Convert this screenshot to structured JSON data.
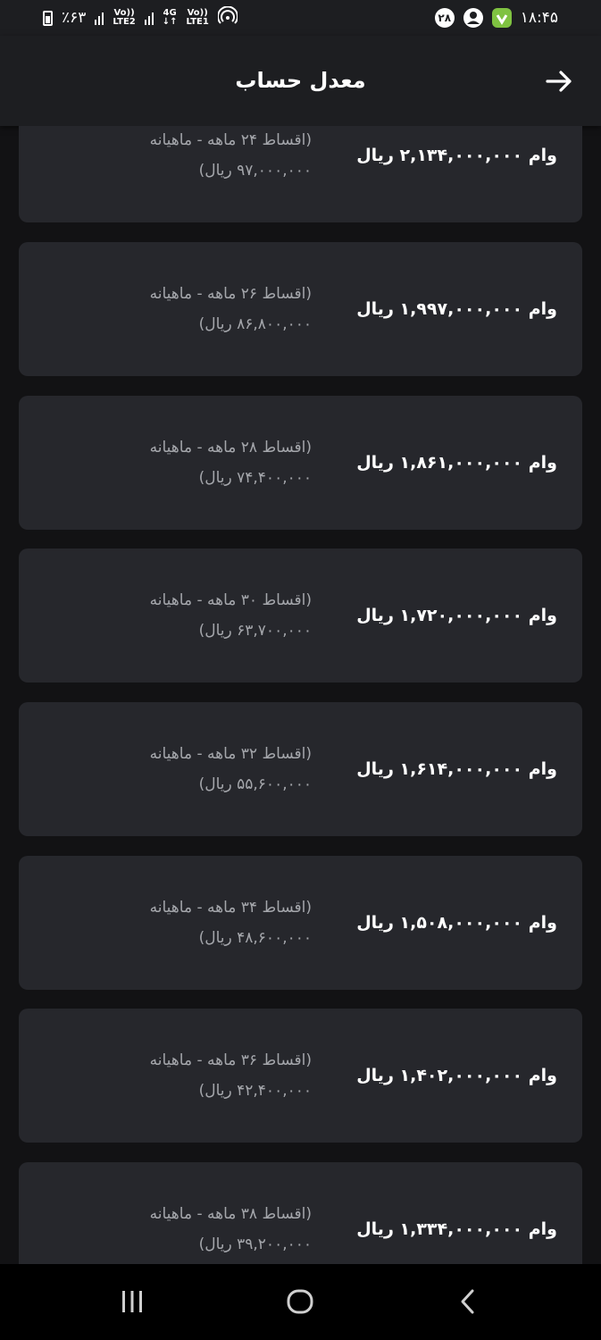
{
  "status_bar": {
    "time": "۱۸:۴۵",
    "notification_badge": "۲۸",
    "battery": "٪۶۳",
    "sim2_label": "LTE2",
    "sim1_label": "LTE1",
    "network_4g": "4G",
    "volte_label": "Vo))"
  },
  "header": {
    "title": "معدل حساب"
  },
  "loans": [
    {
      "amount": "وام ۲,۱۳۴,۰۰۰,۰۰۰ ریال",
      "term": "(اقساط ۲۴ ماهه - ماهیانه",
      "payment": "۹۷,۰۰۰,۰۰۰ ریال)"
    },
    {
      "amount": "وام ۱,۹۹۷,۰۰۰,۰۰۰ ریال",
      "term": "(اقساط ۲۶ ماهه - ماهیانه",
      "payment": "۸۶,۸۰۰,۰۰۰ ریال)"
    },
    {
      "amount": "وام ۱,۸۶۱,۰۰۰,۰۰۰ ریال",
      "term": "(اقساط ۲۸ ماهه - ماهیانه",
      "payment": "۷۴,۴۰۰,۰۰۰ ریال)"
    },
    {
      "amount": "وام ۱,۷۲۰,۰۰۰,۰۰۰ ریال",
      "term": "(اقساط ۳۰ ماهه - ماهیانه",
      "payment": "۶۳,۷۰۰,۰۰۰ ریال)"
    },
    {
      "amount": "وام ۱,۶۱۴,۰۰۰,۰۰۰ ریال",
      "term": "(اقساط ۳۲ ماهه - ماهیانه",
      "payment": "۵۵,۶۰۰,۰۰۰ ریال)"
    },
    {
      "amount": "وام ۱,۵۰۸,۰۰۰,۰۰۰ ریال",
      "term": "(اقساط ۳۴ ماهه - ماهیانه",
      "payment": "۴۸,۶۰۰,۰۰۰ ریال)"
    },
    {
      "amount": "وام ۱,۴۰۲,۰۰۰,۰۰۰ ریال",
      "term": "(اقساط ۳۶ ماهه - ماهیانه",
      "payment": "۴۲,۴۰۰,۰۰۰ ریال)"
    },
    {
      "amount": "وام ۱,۳۳۴,۰۰۰,۰۰۰ ریال",
      "term": "(اقساط ۳۸ ماهه - ماهیانه",
      "payment": "۳۹,۲۰۰,۰۰۰ ریال)"
    }
  ],
  "icons": {
    "back": "arrow-right-icon",
    "nav_recents": "recent-apps-icon",
    "nav_home": "home-icon",
    "nav_back": "chevron-left-icon"
  },
  "colors": {
    "background": "#121214",
    "card": "#26272c",
    "header": "#1d1e21",
    "secondary_text": "#a4a6ab"
  }
}
